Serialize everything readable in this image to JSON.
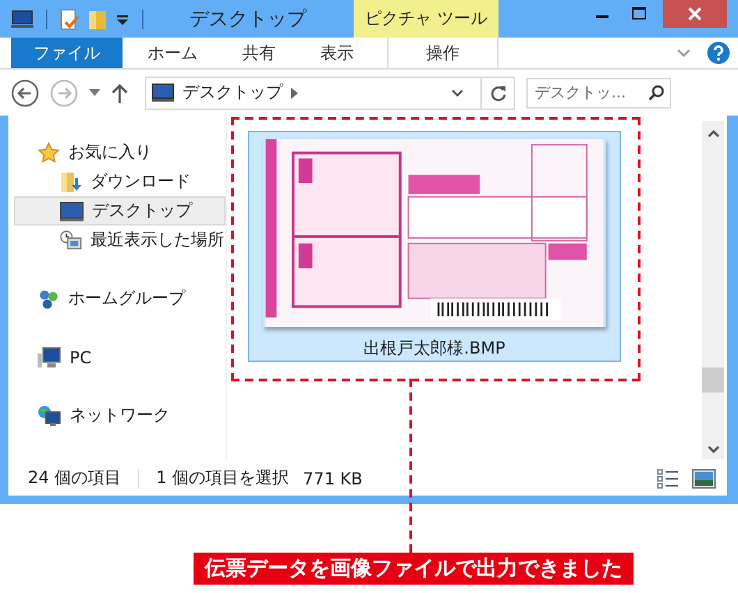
{
  "window": {
    "title": "デスクトップ",
    "context_tab": "ピクチャ ツール"
  },
  "ribbon_tabs": [
    {
      "label": "ファイル",
      "kind": "file"
    },
    {
      "label": "ホーム",
      "kind": "tab"
    },
    {
      "label": "共有",
      "kind": "tab"
    },
    {
      "label": "表示",
      "kind": "tab"
    },
    {
      "label": "操作",
      "kind": "context"
    }
  ],
  "navigation": {
    "back": {
      "disabled": false
    },
    "forward": {
      "disabled": true
    }
  },
  "address": {
    "path": "デスクトップ"
  },
  "search": {
    "placeholder": "デスクトッ..."
  },
  "nav_pane": [
    {
      "label": "お気に入り",
      "kind": "star",
      "selected": false,
      "children": [
        {
          "label": "ダウンロード",
          "kind": "download",
          "selected": false
        },
        {
          "label": "デスクトップ",
          "kind": "desktop",
          "selected": true
        },
        {
          "label": "最近表示した場所",
          "kind": "recent",
          "selected": false
        }
      ]
    },
    {
      "label": "ホームグループ",
      "kind": "homegroup",
      "selected": false
    },
    {
      "label": "PC",
      "kind": "pc",
      "selected": false
    },
    {
      "label": "ネットワーク",
      "kind": "network",
      "selected": false
    }
  ],
  "files": [
    {
      "name": "出根戸太郎様.BMP",
      "kind": "picture",
      "selected": true
    }
  ],
  "status_bar": {
    "item_count": "24 個の項目",
    "selection": "1 個の項目を選択",
    "size": "771 KB"
  },
  "callout": {
    "text": "伝票データを画像ファイルで出力できました"
  }
}
